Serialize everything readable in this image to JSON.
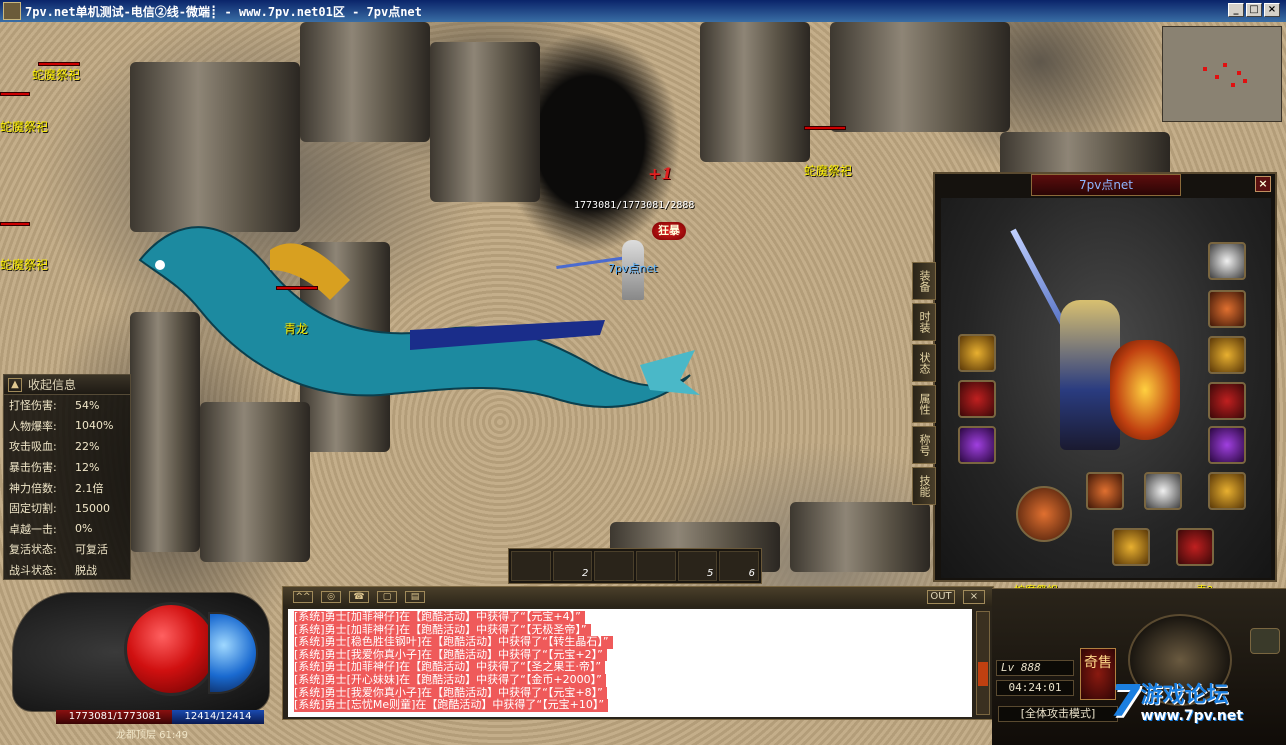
{
  "window": {
    "title": "7pv.net单机测试-电信②线-微端┋ - www.7pv.net01区 - 7pv点net",
    "controls": [
      "_",
      "□",
      "×"
    ]
  },
  "scene": {
    "mobs": [
      {
        "name": "蛇魔祭祀"
      },
      {
        "name": "蛇魔祭祀"
      },
      {
        "name": "蛇魔祭祀"
      },
      {
        "name": "蛇魔祭祀"
      }
    ],
    "dragon_name": "青龙",
    "damage_popup": "+1",
    "player": {
      "hp_line": "1773081/1773081/2888",
      "name": "7pv点net",
      "badge": "狂暴"
    },
    "bottom_mob_names": [
      "蛇魔祭祀",
      "青?"
    ]
  },
  "stats_panel": {
    "toggle": "▲",
    "header": "收起信息",
    "rows": [
      {
        "k": "打怪伤害:",
        "v": "54%"
      },
      {
        "k": "人物爆率:",
        "v": "1040%"
      },
      {
        "k": "攻击吸血:",
        "v": "22%"
      },
      {
        "k": "暴击伤害:",
        "v": "12%"
      },
      {
        "k": "神力倍数:",
        "v": "2.1倍"
      },
      {
        "k": "固定切割:",
        "v": "15000"
      },
      {
        "k": "卓越一击:",
        "v": "0%"
      },
      {
        "k": "复活状态:",
        "v": "可复活"
      },
      {
        "k": "战斗状态:",
        "v": "脱战"
      }
    ]
  },
  "char_panel": {
    "title": "7pv点net",
    "close": "×",
    "tabs": [
      "装备",
      "时装",
      "状态",
      "属性",
      "称号",
      "技能"
    ]
  },
  "skillbar": {
    "slots": [
      "",
      "2",
      "",
      "",
      "5",
      "6"
    ]
  },
  "chat": {
    "icons": [
      "^^",
      "◎",
      "☎",
      "▢",
      "▤"
    ],
    "out_label": "OUT",
    "close_label": "×",
    "lines": [
      "[系统]勇士[加菲神仔]在【跑酷活动】中获得了“【元宝+4】”",
      "[系统]勇士[加菲神仔]在【跑酷活动】中获得了“【无极圣帝】”",
      "[系统]勇士[稳色胜佳钢叶]在【跑酷活动】中获得了“【转生晶石】”",
      "[系统]勇士[我爱你真小子]在【跑酷活动】中获得了“【元宝+2】”",
      "[系统]勇士[加菲神仔]在【跑酷活动】中获得了“【圣之果王·帝】”",
      "[系统]勇士[开心妹妹]在【跑酷活动】中获得了“【金币+2000】”",
      "[系统]勇士[我爱你真小子]在【跑酷活动】中获得了“【元宝+8】”",
      "[系统]勇士[忘忧Me则童]在【跑酷活动】中获得了“【元宝+10】”"
    ]
  },
  "hud_left": {
    "hp": "1773081/1773081",
    "mp": "12414/12414",
    "map": "龙都顶层 61:49"
  },
  "hud_right": {
    "level": "Lv  888",
    "clock": "04:24:01",
    "shop": "奇售",
    "attack_mode": "[全体攻击模式]"
  },
  "watermark": {
    "seven": "7",
    "line1": "游戏论坛",
    "line2": "www.7pv.net"
  },
  "colors": {
    "hp": "#d01010",
    "mp": "#1a6ad0",
    "chat_highlight": "#ef5a5a",
    "mob_name": "#fff200",
    "player_name": "#5ab4ff"
  }
}
